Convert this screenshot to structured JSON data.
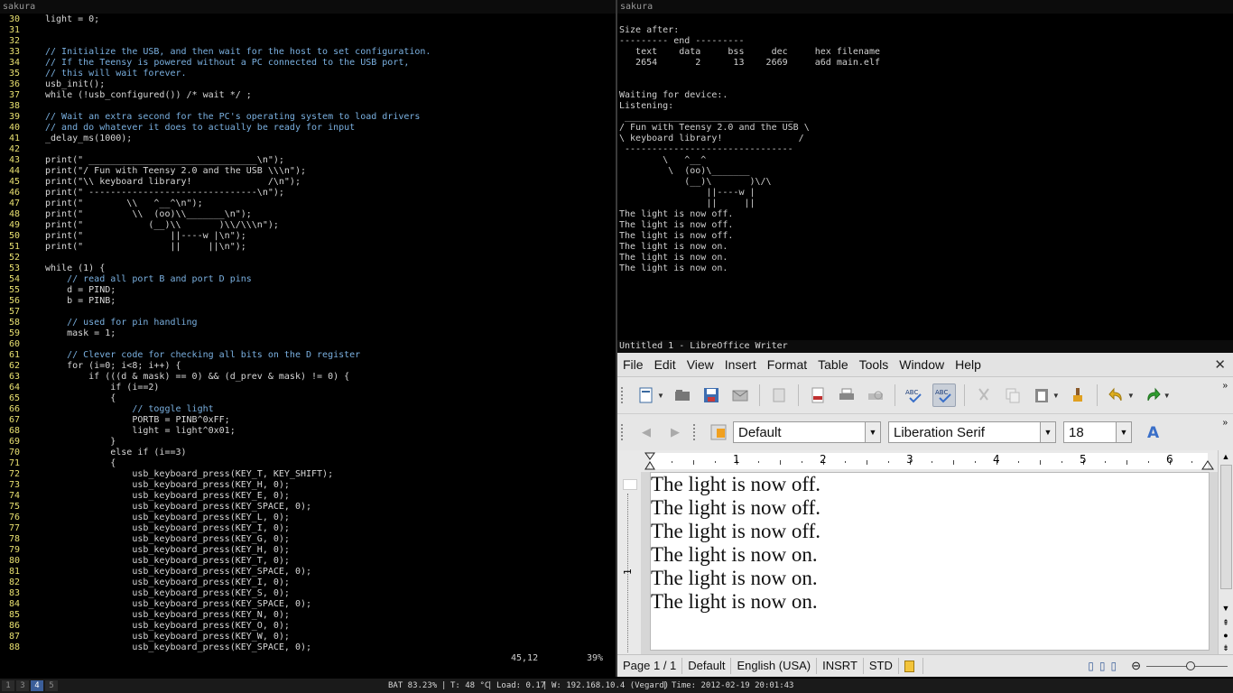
{
  "left_term": {
    "title": "sakura",
    "lines": [
      {
        "n": "30",
        "t": "light = 0;",
        "c": false
      },
      {
        "n": "31",
        "t": "",
        "c": false
      },
      {
        "n": "32",
        "t": "",
        "c": false
      },
      {
        "n": "33",
        "t": "// Initialize the USB, and then wait for the host to set configuration.",
        "c": true
      },
      {
        "n": "34",
        "t": "// If the Teensy is powered without a PC connected to the USB port,",
        "c": true
      },
      {
        "n": "35",
        "t": "// this will wait forever.",
        "c": true
      },
      {
        "n": "36",
        "t": "usb_init();",
        "c": false
      },
      {
        "n": "37",
        "t": "while (!usb_configured()) /* wait */ ;",
        "c": false
      },
      {
        "n": "38",
        "t": "",
        "c": false
      },
      {
        "n": "39",
        "t": "// Wait an extra second for the PC's operating system to load drivers",
        "c": true
      },
      {
        "n": "40",
        "t": "// and do whatever it does to actually be ready for input",
        "c": true
      },
      {
        "n": "41",
        "t": "_delay_ms(1000);",
        "c": false
      },
      {
        "n": "42",
        "t": "",
        "c": false
      },
      {
        "n": "43",
        "t": "print(\" _______________________________\\n\");",
        "c": false
      },
      {
        "n": "44",
        "t": "print(\"/ Fun with Teensy 2.0 and the USB \\\\\\n\");",
        "c": false
      },
      {
        "n": "45",
        "t": "print(\"\\\\ keyboard library!              /\\n\");",
        "c": false
      },
      {
        "n": "46",
        "t": "print(\" -------------------------------\\n\");",
        "c": false
      },
      {
        "n": "47",
        "t": "print(\"        \\\\   ^__^\\n\");",
        "c": false
      },
      {
        "n": "48",
        "t": "print(\"         \\\\  (oo)\\\\_______\\n\");",
        "c": false
      },
      {
        "n": "49",
        "t": "print(\"            (__)\\\\       )\\\\/\\\\\\n\");",
        "c": false
      },
      {
        "n": "50",
        "t": "print(\"                ||----w |\\n\");",
        "c": false
      },
      {
        "n": "51",
        "t": "print(\"                ||     ||\\n\");",
        "c": false
      },
      {
        "n": "52",
        "t": "",
        "c": false
      },
      {
        "n": "53",
        "t": "while (1) {",
        "c": false
      },
      {
        "n": "54",
        "t": "    // read all port B and port D pins",
        "c": true
      },
      {
        "n": "55",
        "t": "    d = PIND;",
        "c": false
      },
      {
        "n": "56",
        "t": "    b = PINB;",
        "c": false
      },
      {
        "n": "57",
        "t": "",
        "c": false
      },
      {
        "n": "58",
        "t": "    // used for pin handling",
        "c": true
      },
      {
        "n": "59",
        "t": "    mask = 1;",
        "c": false
      },
      {
        "n": "60",
        "t": "",
        "c": false
      },
      {
        "n": "61",
        "t": "    // Clever code for checking all bits on the D register",
        "c": true
      },
      {
        "n": "62",
        "t": "    for (i=0; i<8; i++) {",
        "c": false
      },
      {
        "n": "63",
        "t": "        if (((d & mask) == 0) && (d_prev & mask) != 0) {",
        "c": false
      },
      {
        "n": "64",
        "t": "            if (i==2)",
        "c": false
      },
      {
        "n": "65",
        "t": "            {",
        "c": false
      },
      {
        "n": "66",
        "t": "                // toggle light",
        "c": true
      },
      {
        "n": "67",
        "t": "                PORTB = PINB^0xFF;",
        "c": false
      },
      {
        "n": "68",
        "t": "                light = light^0x01;",
        "c": false
      },
      {
        "n": "69",
        "t": "            }",
        "c": false
      },
      {
        "n": "70",
        "t": "            else if (i==3)",
        "c": false
      },
      {
        "n": "71",
        "t": "            {",
        "c": false
      },
      {
        "n": "72",
        "t": "                usb_keyboard_press(KEY_T, KEY_SHIFT);",
        "c": false
      },
      {
        "n": "73",
        "t": "                usb_keyboard_press(KEY_H, 0);",
        "c": false
      },
      {
        "n": "74",
        "t": "                usb_keyboard_press(KEY_E, 0);",
        "c": false
      },
      {
        "n": "75",
        "t": "                usb_keyboard_press(KEY_SPACE, 0);",
        "c": false
      },
      {
        "n": "76",
        "t": "                usb_keyboard_press(KEY_L, 0);",
        "c": false
      },
      {
        "n": "77",
        "t": "                usb_keyboard_press(KEY_I, 0);",
        "c": false
      },
      {
        "n": "78",
        "t": "                usb_keyboard_press(KEY_G, 0);",
        "c": false
      },
      {
        "n": "79",
        "t": "                usb_keyboard_press(KEY_H, 0);",
        "c": false
      },
      {
        "n": "80",
        "t": "                usb_keyboard_press(KEY_T, 0);",
        "c": false
      },
      {
        "n": "81",
        "t": "                usb_keyboard_press(KEY_SPACE, 0);",
        "c": false
      },
      {
        "n": "82",
        "t": "                usb_keyboard_press(KEY_I, 0);",
        "c": false
      },
      {
        "n": "83",
        "t": "                usb_keyboard_press(KEY_S, 0);",
        "c": false
      },
      {
        "n": "84",
        "t": "                usb_keyboard_press(KEY_SPACE, 0);",
        "c": false
      },
      {
        "n": "85",
        "t": "                usb_keyboard_press(KEY_N, 0);",
        "c": false
      },
      {
        "n": "86",
        "t": "                usb_keyboard_press(KEY_O, 0);",
        "c": false
      },
      {
        "n": "87",
        "t": "                usb_keyboard_press(KEY_W, 0);",
        "c": false
      },
      {
        "n": "88",
        "t": "                usb_keyboard_press(KEY_SPACE, 0);",
        "c": false
      }
    ],
    "ruler_pos": "45,12",
    "ruler_pct": "39%"
  },
  "right_term": {
    "title": "sakura",
    "output": "\nSize after:\n--------- end ---------\n   text    data     bss     dec     hex filename\n   2654       2      13    2669     a6d main.elf\n\n\nWaiting for device:.\nListening:\n _______________________________\n/ Fun with Teensy 2.0 and the USB \\\n\\ keyboard library!              /\n -------------------------------\n        \\   ^__^\n         \\  (oo)\\_______\n            (__)\\       )\\/\\\n                ||----w |\n                ||     ||\nThe light is now off.\nThe light is now off.\nThe light is now off.\nThe light is now on.\nThe light is now on.\nThe light is now on."
  },
  "writer": {
    "window_title": "Untitled 1 - LibreOffice Writer",
    "menu": [
      "File",
      "Edit",
      "View",
      "Insert",
      "Format",
      "Table",
      "Tools",
      "Window",
      "Help"
    ],
    "close_label": "✕",
    "style_value": "Default",
    "font_value": "Liberation Serif",
    "size_value": "18",
    "ruler_numbers": [
      "1",
      "2",
      "3",
      "4",
      "5",
      "6"
    ],
    "vruler_number": "1",
    "doc_lines": [
      "The light is now off.",
      "The light is now off.",
      "The light is now off.",
      "The light is now on.",
      "The light is now on.",
      "The light is now on."
    ],
    "status": {
      "page": "Page 1 / 1",
      "style": "Default",
      "language": "English (USA)",
      "insert_mode": "INSRT",
      "selection_mode": "STD"
    }
  },
  "panel": {
    "workspaces": [
      "1",
      "3",
      "4",
      "5"
    ],
    "active_workspace": "4",
    "battery": "BAT 83.23%",
    "temp": "T: 48 °C",
    "load": "Load: 0.17",
    "wifi": "W: 192.168.10.4 (Vegard)",
    "time": "Time: 2012-02-19 20:01:43"
  }
}
